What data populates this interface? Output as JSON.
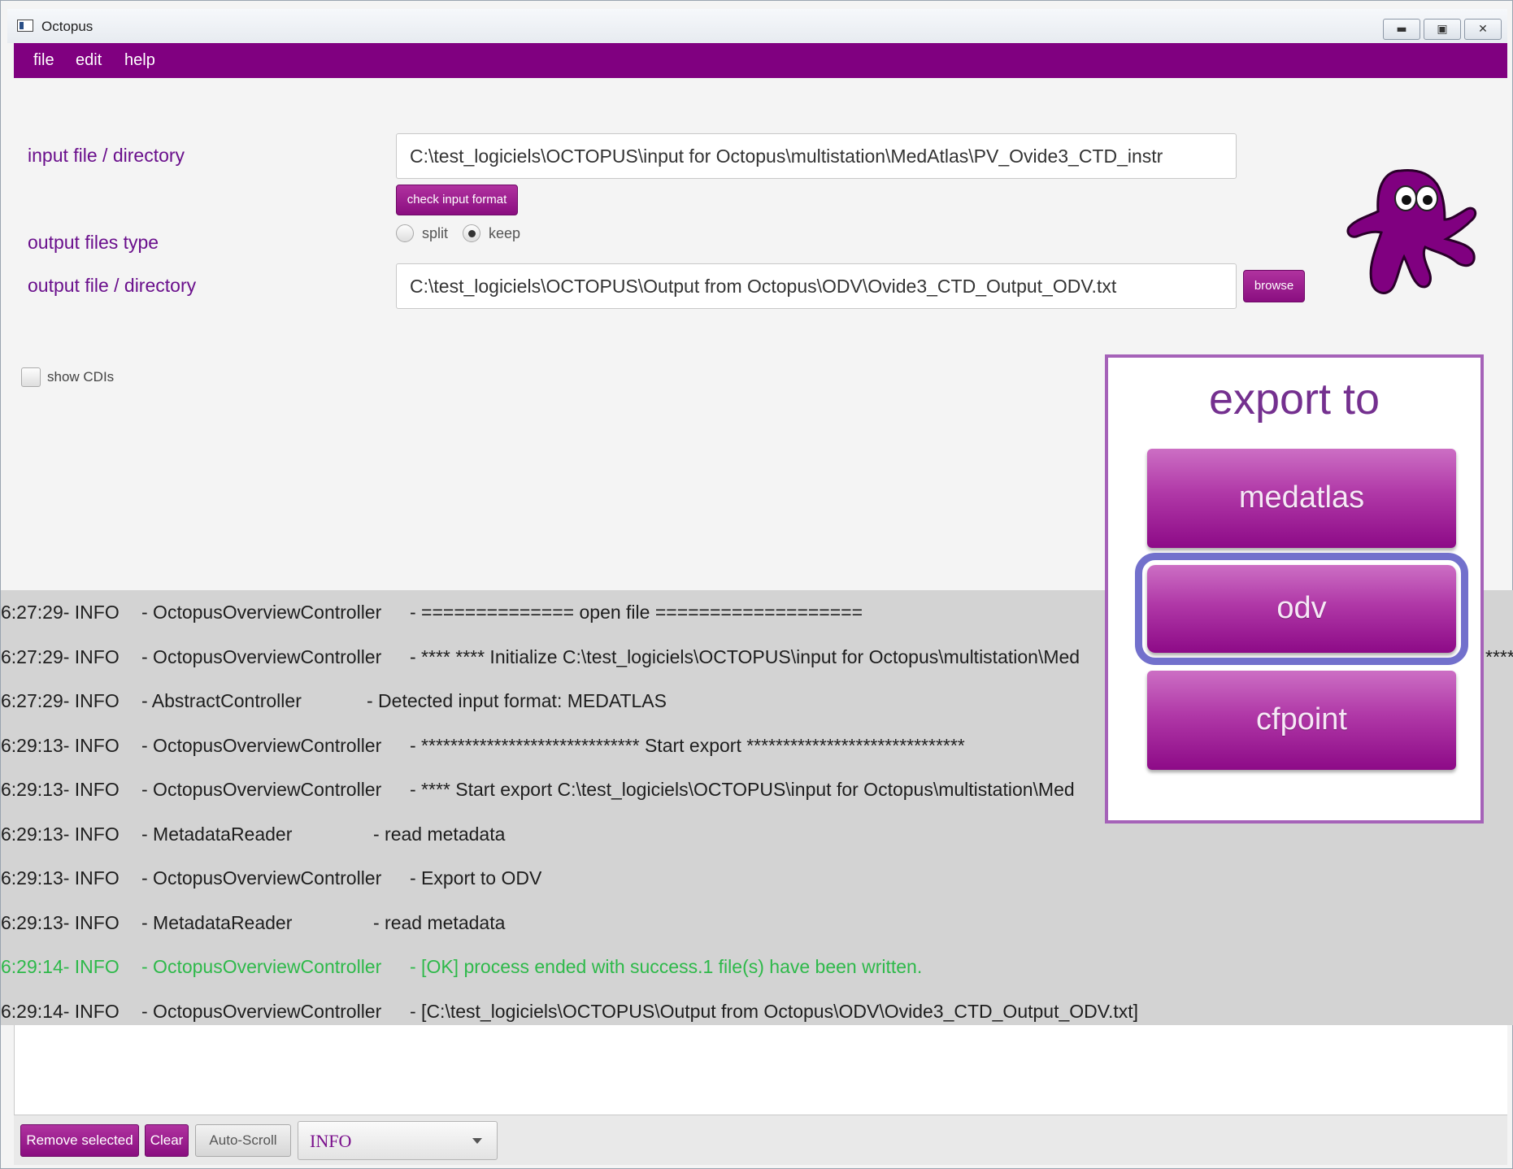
{
  "window": {
    "title": "Octopus"
  },
  "menu": {
    "file": "file",
    "edit": "edit",
    "help": "help"
  },
  "form": {
    "input_label": "input file / directory",
    "input_value": "C:\\test_logiciels\\OCTOPUS\\input for Octopus\\multistation\\MedAtlas\\PV_Ovide3_CTD_instr",
    "check_format_label": "check input format",
    "output_type_label": "output files type",
    "radio_split": "split",
    "radio_keep": "keep",
    "output_label": "output file / directory",
    "output_value": "C:\\test_logiciels\\OCTOPUS\\Output from Octopus\\ODV\\Ovide3_CTD_Output_ODV.txt",
    "browse_label": "browse",
    "show_cdis_label": "show CDIs"
  },
  "log": [
    {
      "time": "6:27:29- INFO",
      "source": "- OctopusOverviewController",
      "msg": "- ============== open file ===================",
      "status": "normal"
    },
    {
      "time": "6:27:29- INFO",
      "source": "- OctopusOverviewController",
      "msg": "- **** **** Initialize C:\\test_logiciels\\OCTOPUS\\input for Octopus\\multistation\\Med",
      "status": "normal"
    },
    {
      "time": "6:27:29- INFO",
      "source": "- AbstractController",
      "msg": "- Detected input format: MEDATLAS",
      "status": "normal"
    },
    {
      "time": "6:29:13- INFO",
      "source": "- OctopusOverviewController",
      "msg": "- ****************************** Start export ******************************",
      "status": "normal"
    },
    {
      "time": "6:29:13- INFO",
      "source": "- OctopusOverviewController",
      "msg": "- **** Start export C:\\test_logiciels\\OCTOPUS\\input for Octopus\\multistation\\Med",
      "status": "normal"
    },
    {
      "time": "6:29:13- INFO",
      "source": "- MetadataReader",
      "msg": "- read metadata",
      "status": "normal"
    },
    {
      "time": "6:29:13- INFO",
      "source": "- OctopusOverviewController",
      "msg": "- Export to ODV",
      "status": "normal"
    },
    {
      "time": "6:29:13- INFO",
      "source": "- MetadataReader",
      "msg": "- read metadata",
      "status": "normal"
    },
    {
      "time": "6:29:14- INFO",
      "source": "- OctopusOverviewController",
      "msg": "- [OK] process ended with success.1 file(s) have been written.",
      "status": "ok"
    },
    {
      "time": "6:29:14- INFO",
      "source": "- OctopusOverviewController",
      "msg": "- [C:\\test_logiciels\\OCTOPUS\\Output from Octopus\\ODV\\Ovide3_CTD_Output_ODV.txt]",
      "status": "normal"
    }
  ],
  "log_overflow": "****",
  "footer": {
    "remove_selected": "Remove selected",
    "clear": "Clear",
    "auto_scroll": "Auto-Scroll",
    "level": "INFO"
  },
  "export": {
    "title": "export to",
    "medatlas": "medatlas",
    "odv": "odv",
    "cfpoint": "cfpoint"
  },
  "colors": {
    "brand_purple": "#800080",
    "label_purple": "#6a0f8c",
    "log_ok_green": "#2eb94a",
    "focus_ring": "#7270cc"
  }
}
